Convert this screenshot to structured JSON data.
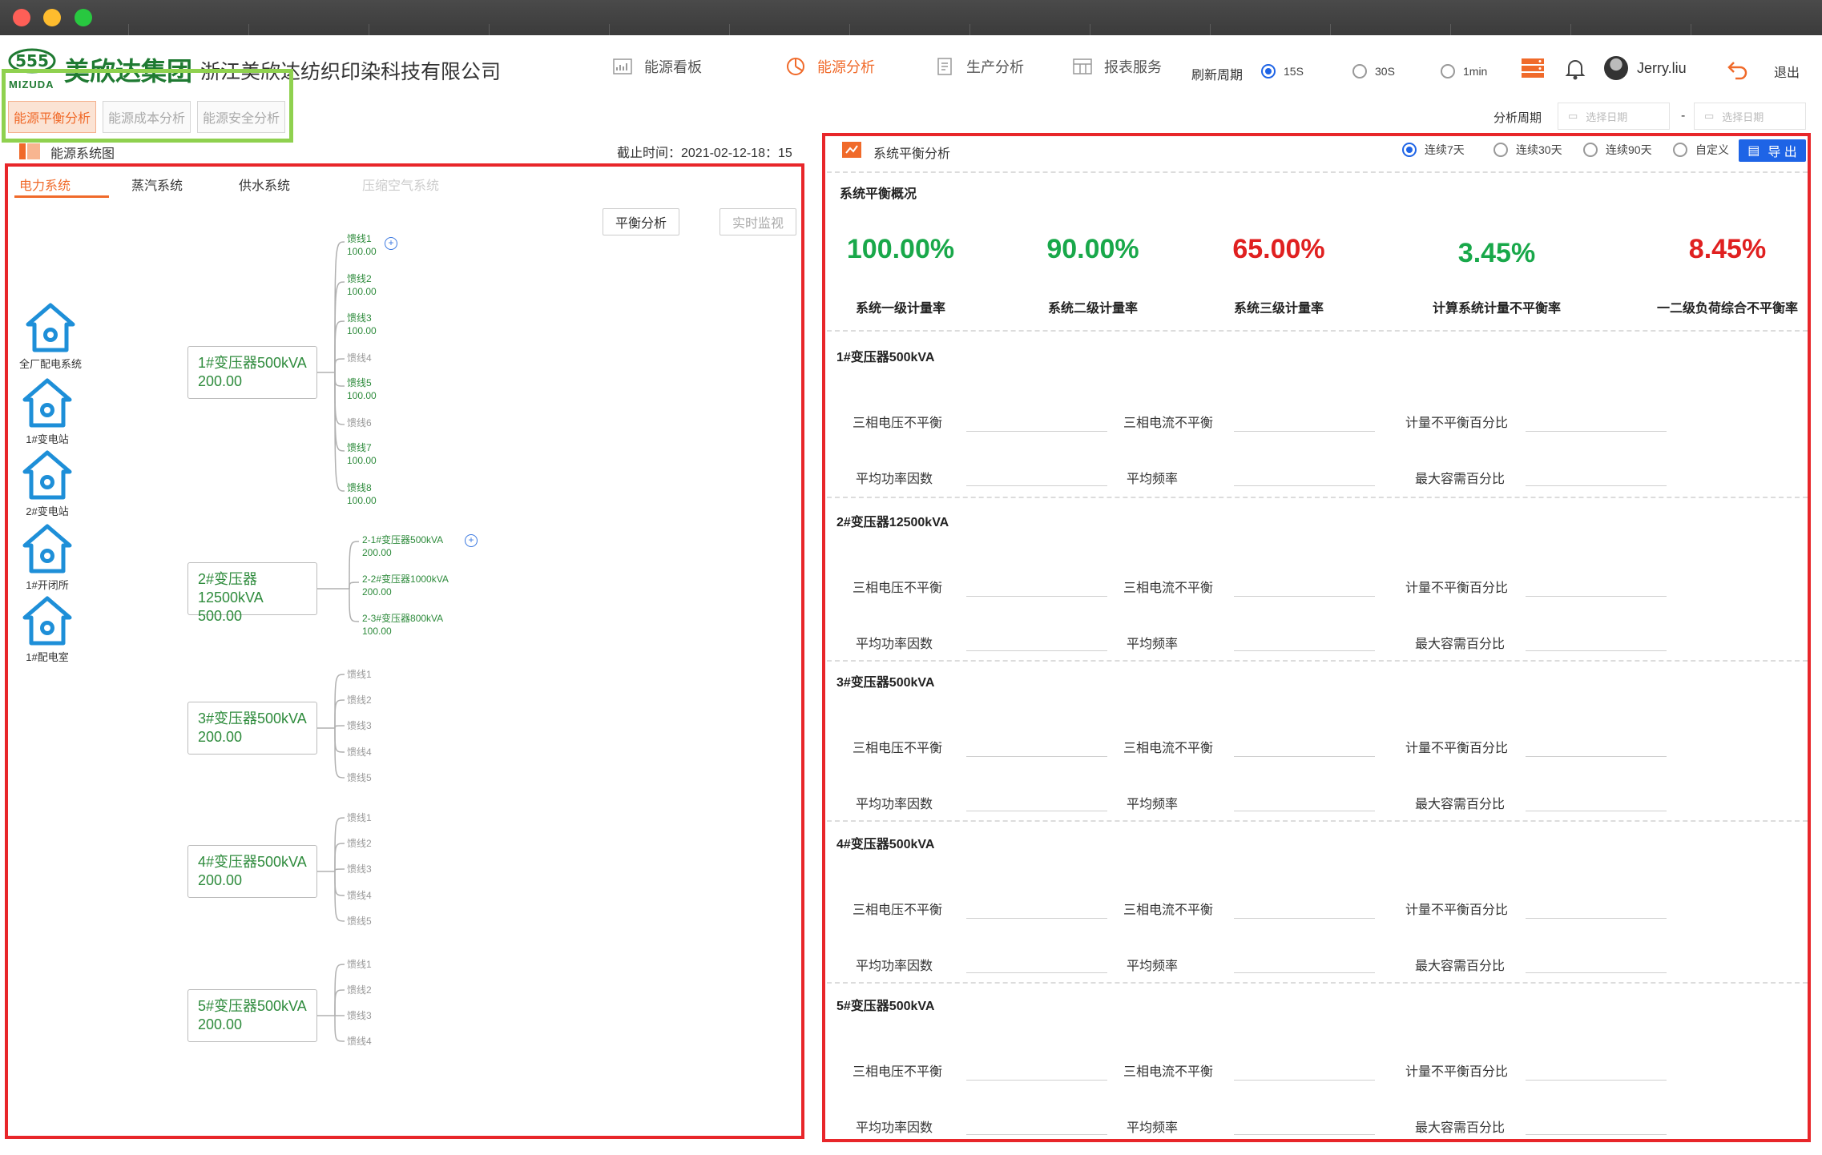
{
  "colors": {
    "accent": "#f06a2a",
    "brand_green": "#1f7a32",
    "value_green": "#19a84a",
    "value_red": "#e02020",
    "primary_blue": "#1e64e6",
    "frame_red": "#e8262a"
  },
  "header": {
    "logo_text": "美欣达集团",
    "logo_en": "MIZUDA",
    "company": "浙江美欣达纺织印染科技有限公司",
    "nav": [
      {
        "label": "能源看板",
        "icon": "chart-icon"
      },
      {
        "label": "能源分析",
        "icon": "pie-icon",
        "active": true
      },
      {
        "label": "生产分析",
        "icon": "doc-icon"
      },
      {
        "label": "报表服务",
        "icon": "table-icon"
      }
    ],
    "refresh_label": "刷新周期",
    "refresh_options": [
      "15S",
      "30S",
      "1min"
    ],
    "refresh_selected": "15S",
    "user": "Jerry.liu",
    "logout": "退出"
  },
  "subtabs": [
    "能源平衡分析",
    "能源成本分析",
    "能源安全分析"
  ],
  "period": {
    "label": "分析周期",
    "start_placeholder": "选择日期",
    "end_placeholder": "选择日期",
    "separator": "-"
  },
  "left": {
    "title": "能源系统图",
    "cutoff": "截止时间：2021-02-12-18：15",
    "system_tabs": [
      "电力系统",
      "蒸汽系统",
      "供水系统",
      "压缩空气系统"
    ],
    "buttons": {
      "balance": "平衡分析",
      "monitor": "实时监视"
    },
    "stations": [
      "全厂配电系统",
      "1#变电站",
      "2#变电站",
      "1#开闭所",
      "1#配电室"
    ],
    "transformers": [
      {
        "name": "1#变压器500kVA",
        "value": "200.00",
        "leaves": [
          {
            "name": "馈线1",
            "value": "100.00"
          },
          {
            "name": "馈线2",
            "value": "100.00"
          },
          {
            "name": "馈线3",
            "value": "100.00"
          },
          {
            "name": "馈线4",
            "value": ""
          },
          {
            "name": "馈线5",
            "value": "100.00"
          },
          {
            "name": "馈线6",
            "value": ""
          },
          {
            "name": "馈线7",
            "value": "100.00"
          },
          {
            "name": "馈线8",
            "value": "100.00"
          }
        ]
      },
      {
        "name": "2#变压器12500kVA",
        "value": "500.00",
        "leaves": [
          {
            "name": "2-1#变压器500kVA",
            "value": "200.00"
          },
          {
            "name": "2-2#变压器1000kVA",
            "value": "200.00"
          },
          {
            "name": "2-3#变压器800kVA",
            "value": "100.00"
          }
        ]
      },
      {
        "name": "3#变压器500kVA",
        "value": "200.00",
        "leaves": [
          {
            "name": "馈线1"
          },
          {
            "name": "馈线2"
          },
          {
            "name": "馈线3"
          },
          {
            "name": "馈线4"
          },
          {
            "name": "馈线5"
          }
        ]
      },
      {
        "name": "4#变压器500kVA",
        "value": "200.00",
        "leaves": [
          {
            "name": "馈线1"
          },
          {
            "name": "馈线2"
          },
          {
            "name": "馈线3"
          },
          {
            "name": "馈线4"
          },
          {
            "name": "馈线5"
          }
        ]
      },
      {
        "name": "5#变压器500kVA",
        "value": "200.00",
        "leaves": [
          {
            "name": "馈线1"
          },
          {
            "name": "馈线2"
          },
          {
            "name": "馈线3"
          },
          {
            "name": "馈线4"
          }
        ]
      }
    ]
  },
  "right": {
    "title": "系统平衡分析",
    "range_options": [
      "连续7天",
      "连续30天",
      "连续90天",
      "自定义"
    ],
    "range_selected": "连续7天",
    "export": "导 出",
    "overview_title": "系统平衡概况",
    "kpis": [
      {
        "value": "100.00%",
        "label": "系统一级计量率",
        "color": "green"
      },
      {
        "value": "90.00%",
        "label": "系统二级计量率",
        "color": "green"
      },
      {
        "value": "65.00%",
        "label": "系统三级计量率",
        "color": "red"
      },
      {
        "value": "3.45%",
        "label": "计算系统计量不平衡率",
        "color": "green"
      },
      {
        "value": "8.45%",
        "label": "一二级负荷综合不平衡率",
        "color": "red"
      }
    ],
    "field_labels": [
      "三相电压不平衡",
      "三相电流不平衡",
      "计量不平衡百分比",
      "平均功率因数",
      "平均频率",
      "最大容需百分比"
    ],
    "sections": [
      "1#变压器500kVA",
      "2#变压器12500kVA",
      "3#变压器500kVA",
      "4#变压器500kVA",
      "5#变压器500kVA"
    ]
  }
}
